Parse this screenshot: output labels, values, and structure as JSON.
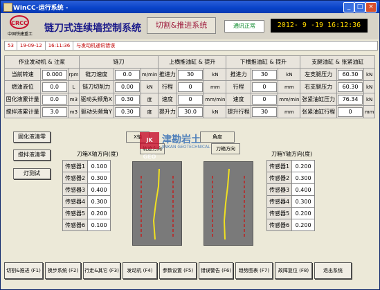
{
  "window": {
    "title": "WinCC-运行系统 -",
    "min": "_",
    "max": "□",
    "close": "×"
  },
  "header": {
    "logo_text": "CRCC",
    "company": "中国铁建重工",
    "system_title": "链刀式连续墙控制系统",
    "mode": "切割&推进系统",
    "comm_status": "通讯正常",
    "clock": "2012- 9 -19 16:12:36"
  },
  "alarm": {
    "id": "53",
    "date": "19-09-12",
    "time": "16:11:36",
    "message": "与发动机通讯错误"
  },
  "params": {
    "headers": [
      "作业发动机 & 注浆",
      "链刀",
      "上横推油缸 & 提升",
      "下横推油缸 & 提升",
      "支腿油缸 & 张紧油缸"
    ],
    "rows": [
      [
        [
          "当前转速",
          "0.000",
          "rpm"
        ],
        [
          "链刀速度",
          "0.0",
          "m/min"
        ],
        [
          "推进力",
          "30",
          "kN"
        ],
        [
          "推进力",
          "30",
          "kN"
        ],
        [
          "左支腿压力",
          "60.30",
          "kN"
        ]
      ],
      [
        [
          "燃油液位",
          "0.0",
          "L"
        ],
        [
          "链刀切削力",
          "0.00",
          "kN"
        ],
        [
          "行程",
          "0",
          "mm"
        ],
        [
          "行程",
          "0",
          "mm"
        ],
        [
          "右支腿压力",
          "60.30",
          "kN"
        ]
      ],
      [
        [
          "固化液累计量",
          "0.0",
          "m3"
        ],
        [
          "驱动头频角X",
          "0.30",
          "度"
        ],
        [
          "速度",
          "0",
          "mm/min"
        ],
        [
          "速度",
          "0",
          "mm/min"
        ],
        [
          "张紧油缸压力",
          "76.34",
          "kN"
        ]
      ],
      [
        [
          "搅拌液累计量",
          "3.0",
          "m3"
        ],
        [
          "驱动头频角Y",
          "0.30",
          "度"
        ],
        [
          "提升力",
          "30.0",
          "kN"
        ],
        [
          "提升行程",
          "30",
          "mm"
        ],
        [
          "张紧油缸行程",
          "0",
          "mm"
        ]
      ]
    ]
  },
  "side_buttons": [
    "固化液清零",
    "搅拌液清零",
    "灯测试"
  ],
  "sensors_x": {
    "title": "刀箱X轴方向(度)",
    "items": [
      [
        "传感器1",
        "0.100"
      ],
      [
        "传感器2",
        "0.300"
      ],
      [
        "传感器3",
        "0.400"
      ],
      [
        "传感器4",
        "0.300"
      ],
      [
        "传感器5",
        "0.200"
      ],
      [
        "传感器6",
        "0.100"
      ]
    ]
  },
  "sensors_y": {
    "title": "刀箱Y轴方向(度)",
    "items": [
      [
        "传感器1",
        "0.200"
      ],
      [
        "传感器2",
        "0.300"
      ],
      [
        "传感器3",
        "0.400"
      ],
      [
        "传感器4",
        "0.300"
      ],
      [
        "传感器5",
        "0.200"
      ],
      [
        "传感器6",
        "0.200"
      ]
    ]
  },
  "panel_labels": {
    "x_left": "X轴",
    "x_small": "轨迹方向",
    "y_right": "角度",
    "y_small": "刀箱方向"
  },
  "watermark": {
    "jk": "JK GEO",
    "cn": "津勘岩土",
    "en": "JINKAN GEOTECHNICAL"
  },
  "bottom_buttons": [
    "切割&推进 (F1)",
    "换步系统 (F2)",
    "行走&其它 (F3)",
    "发动机 (F4)",
    "参数设置 (F5)",
    "错误警告 (F6)",
    "趋势图表 (F7)",
    "故障复位 (F8)",
    "退出系统"
  ],
  "colors": {
    "clock_fg": "#ffd800",
    "title": "#1a1a8a",
    "alarm_fg": "#c00000",
    "comm_fg": "#0a8a2a"
  }
}
